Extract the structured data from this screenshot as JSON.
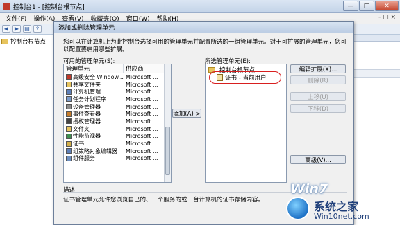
{
  "window": {
    "title": "控制台1 - [控制台根节点]",
    "buttons": {
      "minimize": "—",
      "maximize": "□",
      "close": "✕"
    }
  },
  "menubar": {
    "items": [
      "文件(F)",
      "操作(A)",
      "查看(V)",
      "收藏夹(O)",
      "窗口(W)",
      "帮助(H)"
    ],
    "right_text": "- □ ×"
  },
  "toolbar": {
    "icons": [
      "back-icon",
      "forward-icon",
      "show-tree-icon",
      "export-icon"
    ],
    "glyphs": [
      "◀",
      "▶",
      "▤",
      "⇪"
    ]
  },
  "left_pane": {
    "root_label": "控制台根节点"
  },
  "dialog": {
    "title": "添加或删除管理单元",
    "description": "您可以在计算机上为此控制台选择可用的管理单元并配置所选的一组管理单元。对于可扩展的管理单元，您可以配置要启用哪些扩展。",
    "available_label": "可用的管理单元(S):",
    "columns": [
      "管理单元",
      "供应商"
    ],
    "available": [
      {
        "name": "高级安全 Window...",
        "vendor": "Microsoft ..."
      },
      {
        "name": "共享文件夹",
        "vendor": "Microsoft ..."
      },
      {
        "name": "计算机管理",
        "vendor": "Microsoft ..."
      },
      {
        "name": "任务计划程序",
        "vendor": "Microsoft ..."
      },
      {
        "name": "设备管理器",
        "vendor": "Microsoft ..."
      },
      {
        "name": "事件查看器",
        "vendor": "Microsoft ..."
      },
      {
        "name": "授权管理器",
        "vendor": "Microsoft ..."
      },
      {
        "name": "文件夹",
        "vendor": "Microsoft ..."
      },
      {
        "name": "性能监视器",
        "vendor": "Microsoft ..."
      },
      {
        "name": "证书",
        "vendor": "Microsoft ..."
      },
      {
        "name": "组策略对象编辑器",
        "vendor": "Microsoft ..."
      },
      {
        "name": "组件服务",
        "vendor": "Microsoft ..."
      }
    ],
    "add_button": "添加(A) >",
    "selected_label": "所选管理单元(E):",
    "selected_root": "控制台根节点",
    "selected_child": "证书 - 当前用户",
    "edit_extensions": "编辑扩展(X)...",
    "remove": "删除(R)",
    "move_up": "上移(U)",
    "move_down": "下移(D)",
    "advanced": "高级(V)...",
    "desc_label": "描述:",
    "desc_text": "证书管理单元允许您浏览自己的、一个服务的或一台计算机的证书存储内容。"
  },
  "watermark": {
    "brand": "Win7",
    "site_cn": "系统之家",
    "site_url": "Win10net.com"
  },
  "colors": {
    "highlight_circle": "#d81f1f",
    "watermark_blue": "#1f73c7"
  }
}
